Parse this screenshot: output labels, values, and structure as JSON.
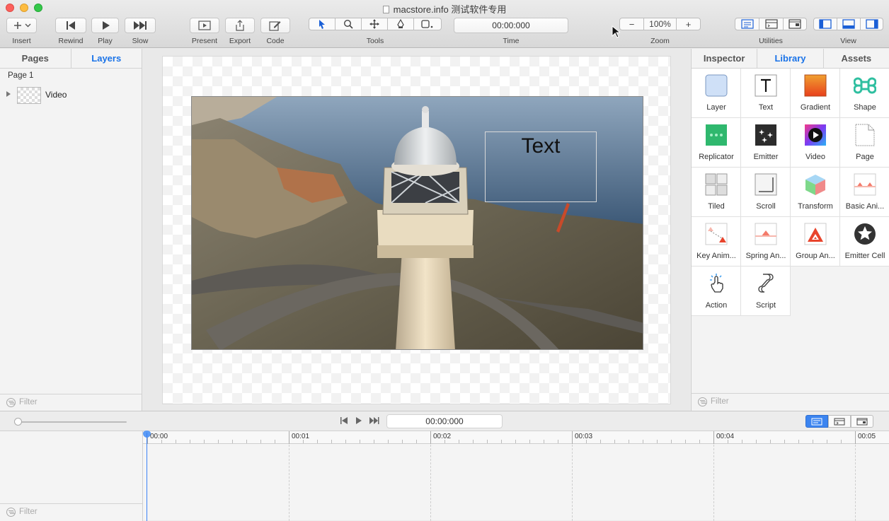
{
  "window": {
    "title": "macstore.info 测试软件专用"
  },
  "toolbar": {
    "insert": "Insert",
    "rewind": "Rewind",
    "play": "Play",
    "slow": "Slow",
    "present": "Present",
    "export": "Export",
    "code": "Code",
    "tools": "Tools",
    "time_label": "Time",
    "time_value": "00:00:000",
    "zoom_label": "Zoom",
    "zoom_value": "100%",
    "zoom_minus": "−",
    "zoom_plus": "+",
    "utilities": "Utilities",
    "view": "View"
  },
  "left_panel": {
    "tabs": [
      {
        "label": "Pages"
      },
      {
        "label": "Layers"
      }
    ],
    "active_tab": "Layers",
    "page_label": "Page 1",
    "layers": [
      {
        "name": "Video"
      }
    ],
    "filter_placeholder": "Filter"
  },
  "canvas": {
    "text_layer": "Text"
  },
  "right_panel": {
    "tabs": [
      {
        "label": "Inspector"
      },
      {
        "label": "Library"
      },
      {
        "label": "Assets"
      }
    ],
    "active_tab": "Library",
    "items": [
      {
        "label": "Layer",
        "icon": "layer-icon"
      },
      {
        "label": "Text",
        "icon": "text-icon"
      },
      {
        "label": "Gradient",
        "icon": "gradient-icon"
      },
      {
        "label": "Shape",
        "icon": "shape-icon"
      },
      {
        "label": "Replicator",
        "icon": "replicator-icon"
      },
      {
        "label": "Emitter",
        "icon": "emitter-icon"
      },
      {
        "label": "Video",
        "icon": "video-icon"
      },
      {
        "label": "Page",
        "icon": "page-icon"
      },
      {
        "label": "Tiled",
        "icon": "tiled-icon"
      },
      {
        "label": "Scroll",
        "icon": "scroll-icon"
      },
      {
        "label": "Transform",
        "icon": "transform-icon"
      },
      {
        "label": "Basic Ani...",
        "icon": "basic-animation-icon"
      },
      {
        "label": "Key Anim...",
        "icon": "key-animation-icon"
      },
      {
        "label": "Spring An...",
        "icon": "spring-animation-icon"
      },
      {
        "label": "Group An...",
        "icon": "group-animation-icon"
      },
      {
        "label": "Emitter Cell",
        "icon": "emitter-cell-icon"
      },
      {
        "label": "Action",
        "icon": "action-icon"
      },
      {
        "label": "Script",
        "icon": "script-icon"
      }
    ],
    "filter_placeholder": "Filter"
  },
  "timeline": {
    "time_value": "00:00:000",
    "ticks": [
      "00:00",
      "00:01",
      "00:02",
      "00:03",
      "00:04",
      "00:05"
    ],
    "filter_placeholder": "Filter"
  },
  "colors": {
    "accent": "#1a73e8",
    "playhead": "#3b82f6"
  }
}
